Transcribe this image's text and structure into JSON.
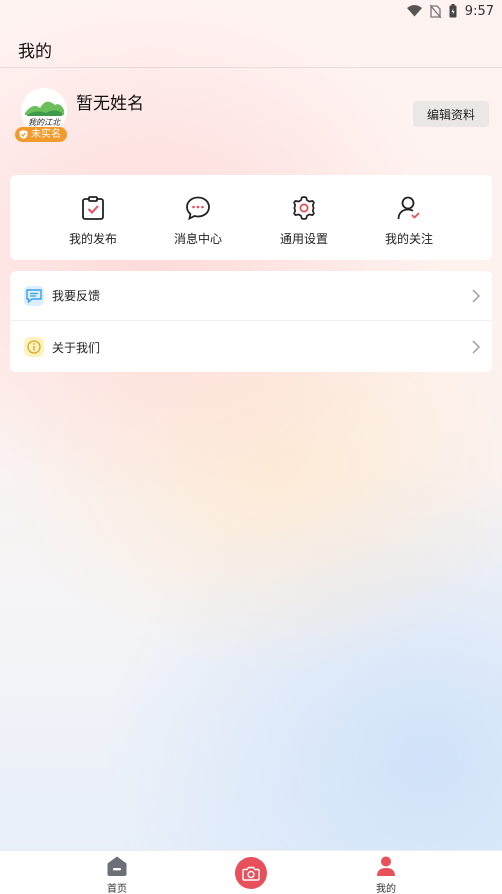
{
  "status_bar": {
    "time": "9:57",
    "icons": [
      "wifi-icon",
      "no-sim-icon",
      "battery-icon"
    ]
  },
  "header": {
    "title": "我的"
  },
  "profile": {
    "name": "暂无姓名",
    "avatar_logo_text": "我的江北",
    "verify_badge": "未实名",
    "edit_label": "编辑资料"
  },
  "quick_menu": [
    {
      "label": "我的发布",
      "icon": "clipboard-check-icon"
    },
    {
      "label": "消息中心",
      "icon": "chat-bubble-icon"
    },
    {
      "label": "通用设置",
      "icon": "gear-icon"
    },
    {
      "label": "我的关注",
      "icon": "user-check-icon"
    }
  ],
  "list": [
    {
      "label": "我要反馈",
      "icon": "feedback-icon",
      "color": "#3aa0e8"
    },
    {
      "label": "关于我们",
      "icon": "info-icon",
      "color": "#e8c437"
    }
  ],
  "bottom_nav": {
    "items": [
      {
        "label": "首页",
        "icon": "home-icon",
        "active": false
      },
      {
        "label": "我的",
        "icon": "user-icon",
        "active": true
      }
    ],
    "center_icon": "camera-icon"
  },
  "colors": {
    "accent": "#e8505b",
    "badge": "#f29a2c"
  }
}
